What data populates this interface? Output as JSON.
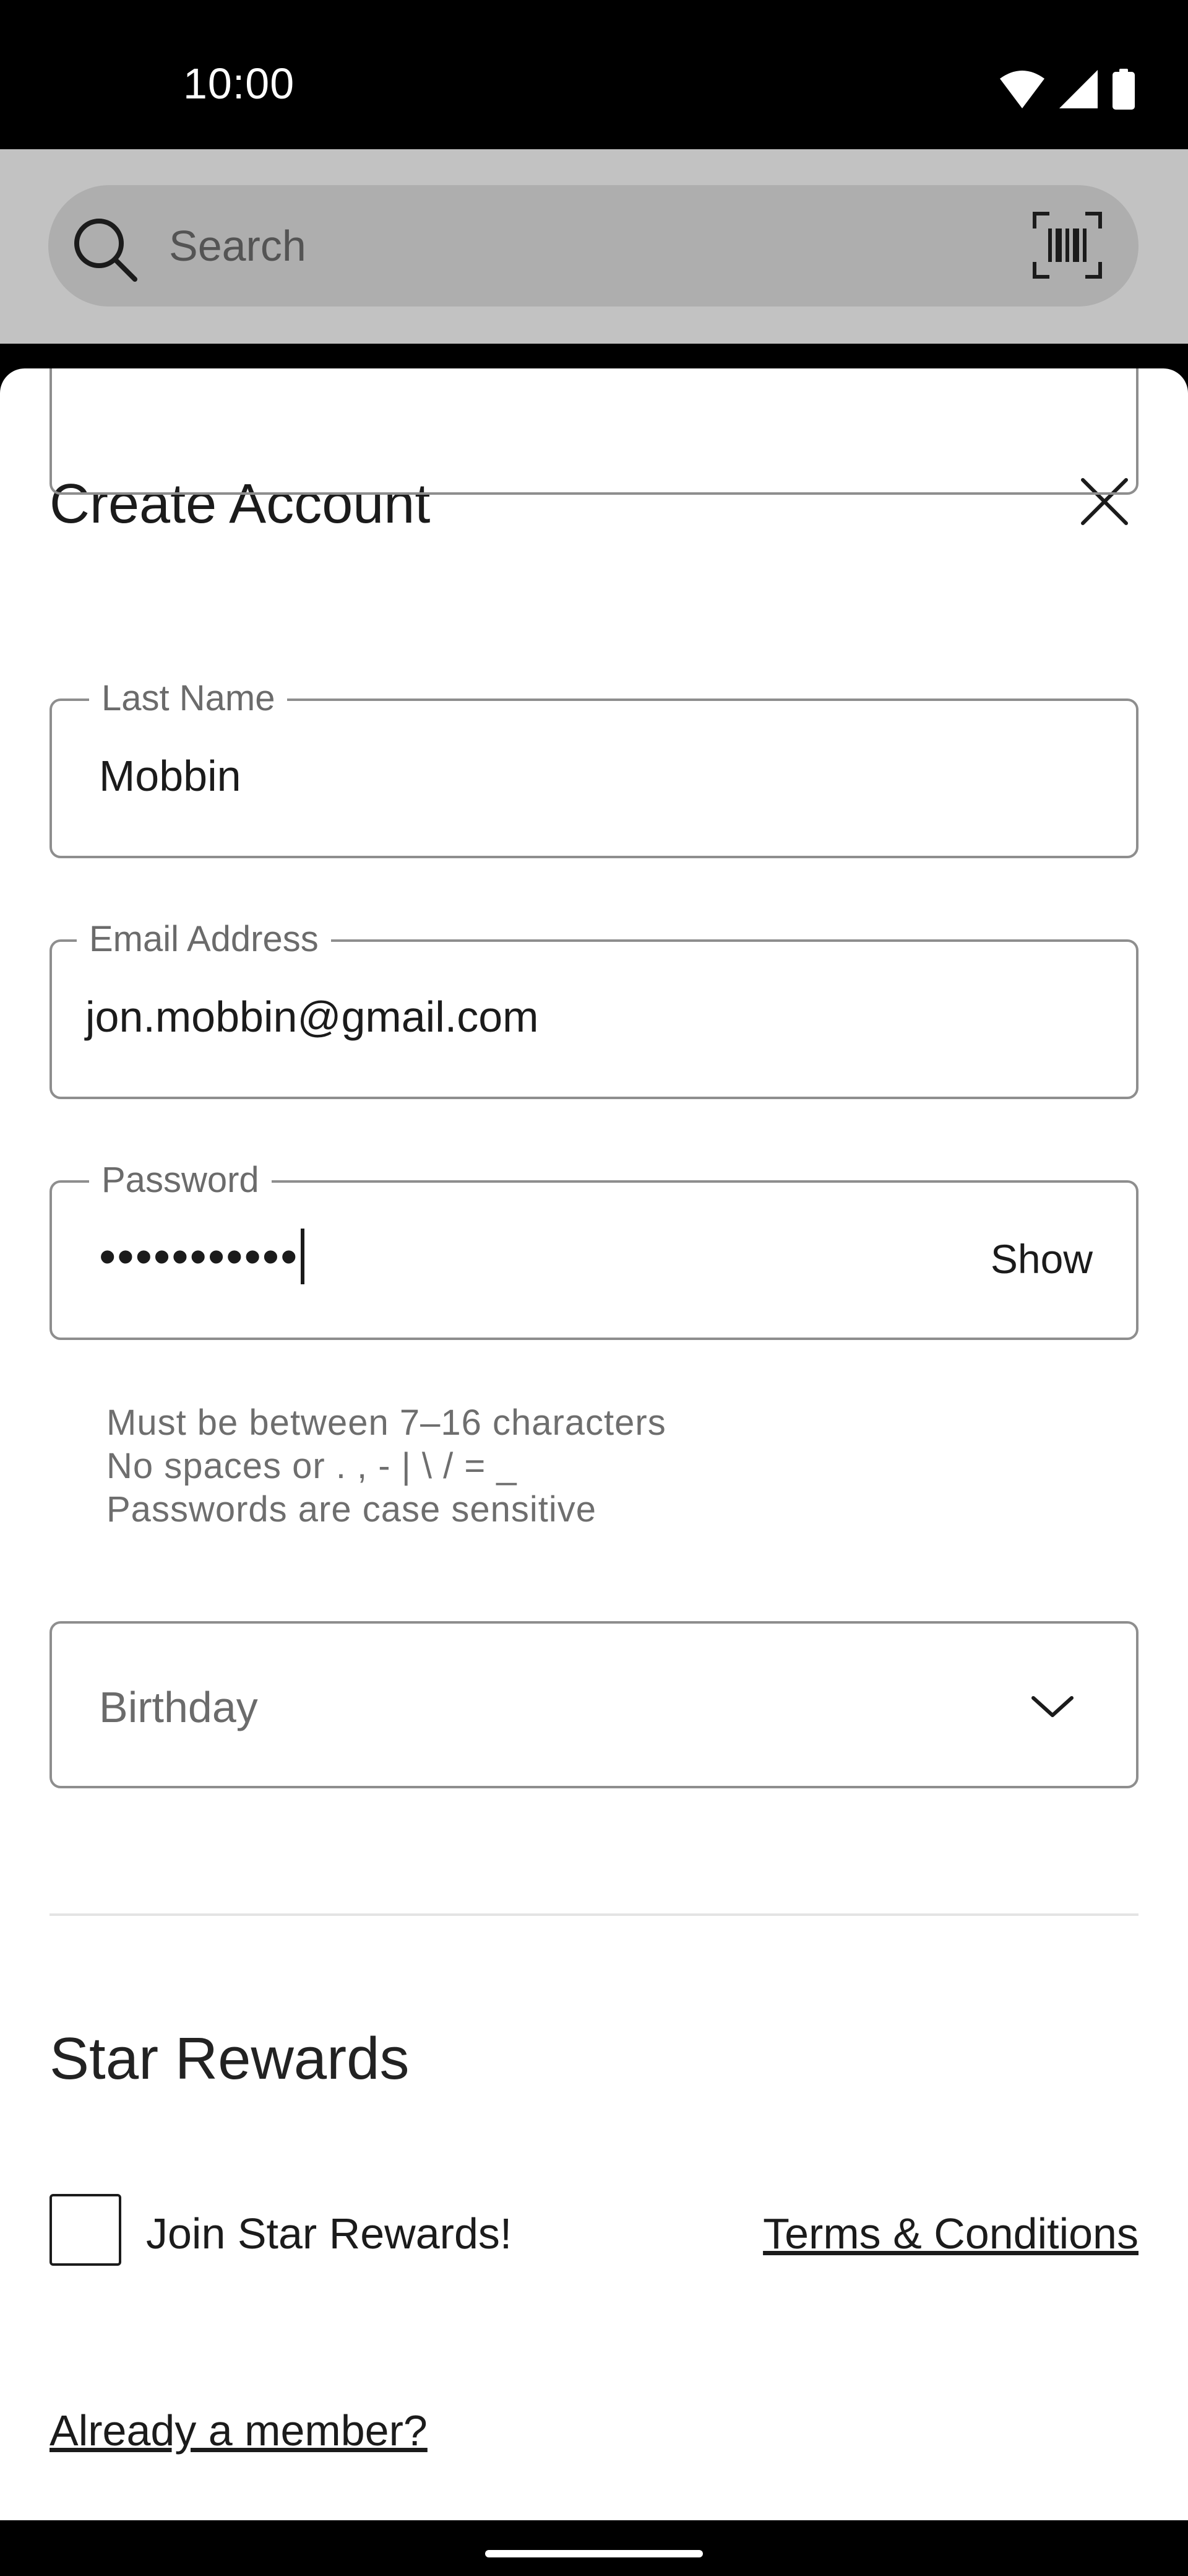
{
  "status_bar": {
    "time": "10:00",
    "icons": [
      "wifi-icon",
      "signal-icon",
      "battery-icon"
    ]
  },
  "search": {
    "placeholder": "Search",
    "icon": "search-icon",
    "barcode_icon": "barcode-icon"
  },
  "sheet": {
    "title": "Create Account",
    "close_icon": "close-icon",
    "fields": {
      "last_name": {
        "label": "Last Name",
        "value": "Mobbin"
      },
      "email": {
        "label": "Email Address",
        "value": "jon.mobbin@gmail.com"
      },
      "password": {
        "label": "Password",
        "value": "•••••••••••",
        "toggle": "Show"
      },
      "birthday": {
        "placeholder": "Birthday"
      }
    },
    "password_rules": [
      "Must be between 7–16 characters",
      "No spaces or . , - | \\ / = _",
      "Passwords are case sensitive"
    ],
    "rewards": {
      "title": "Star Rewards",
      "checkbox_label": "Join Star Rewards!",
      "checked": false,
      "terms_link": "Terms & Conditions"
    },
    "member_link": "Already a member?"
  },
  "colors": {
    "accent": "#1b1b1b",
    "app_bar": "#c2c2c2",
    "search_pill": "#aeaeae",
    "field_border": "#8e8e8e"
  }
}
